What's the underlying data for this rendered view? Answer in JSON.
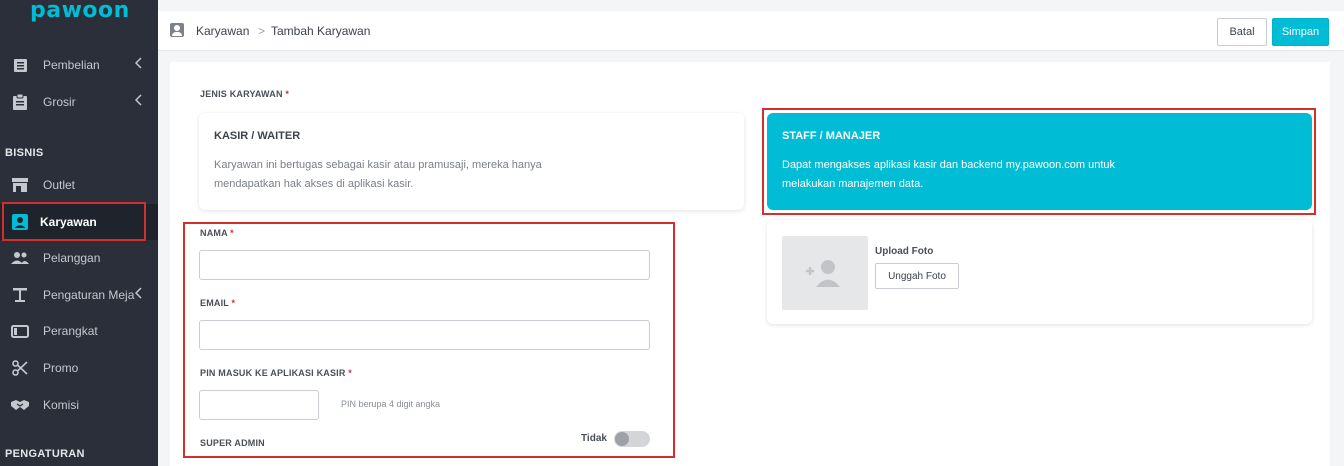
{
  "brand": {
    "logo": "pawoon",
    "accent": "#00bcd4"
  },
  "sidebar": {
    "items_top": [
      {
        "label": "Pembelian",
        "icon": "list-icon"
      },
      {
        "label": "Grosir",
        "icon": "clipboard-icon"
      }
    ],
    "section_bisnis": "BISNIS",
    "items_bisnis": [
      {
        "label": "Outlet",
        "icon": "store-icon"
      },
      {
        "label": "Karyawan",
        "icon": "employee-icon",
        "active": true
      },
      {
        "label": "Pelanggan",
        "icon": "customers-icon"
      },
      {
        "label": "Pengaturan Meja",
        "icon": "table-icon"
      },
      {
        "label": "Perangkat",
        "icon": "device-icon"
      },
      {
        "label": "Promo",
        "icon": "scissors-icon"
      },
      {
        "label": "Komisi",
        "icon": "handshake-icon"
      }
    ],
    "section_pengaturan": "PENGATURAN"
  },
  "header": {
    "breadcrumb_root": "Karyawan",
    "breadcrumb_current": "Tambah Karyawan",
    "separator": ">",
    "cancel_label": "Batal",
    "save_label": "Simpan"
  },
  "form": {
    "employee_type_label": "JENIS KARYAWAN",
    "required_mark": "*",
    "types": [
      {
        "title": "KASIR / WAITER",
        "desc_line1": "Karyawan ini bertugas sebagai kasir atau pramusaji, mereka hanya",
        "desc_line2": "mendapatkan hak akses di aplikasi kasir.",
        "selected": false
      },
      {
        "title": "STAFF / MANAJER",
        "desc_line1": "Dapat mengakses aplikasi kasir dan backend my.pawoon.com untuk",
        "desc_line2": "melakukan manajemen data.",
        "selected": true
      }
    ],
    "name_label": "NAMA",
    "name_value": "",
    "email_label": "EMAIL",
    "email_value": "",
    "pin_label": "PIN MASUK KE APLIKASI KASIR",
    "pin_value": "",
    "pin_hint": "PIN berupa 4 digit angka",
    "super_admin_label": "SUPER ADMIN",
    "super_admin_state": "Tidak",
    "upload_photo_label": "Upload Foto",
    "upload_button_label": "Unggah Foto"
  }
}
